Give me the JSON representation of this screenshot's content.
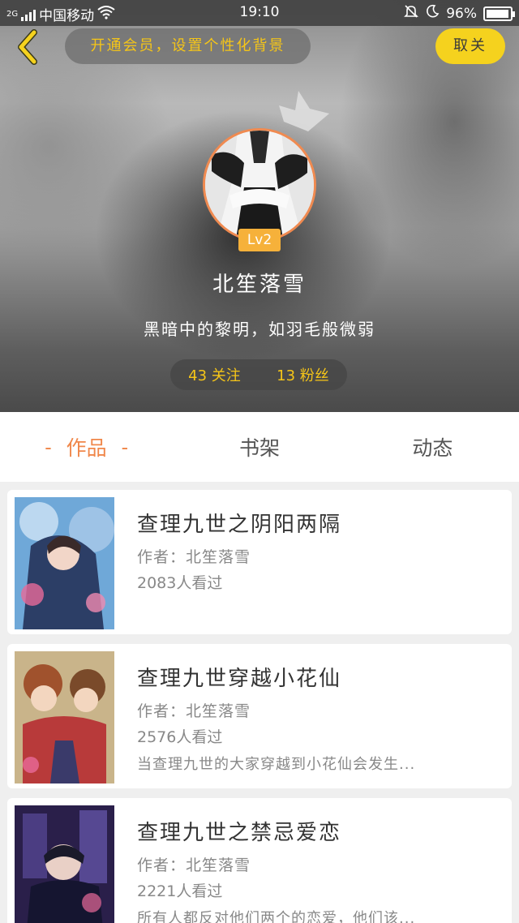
{
  "status_bar": {
    "carrier": "中国移动",
    "network": "2G",
    "time": "19:10",
    "battery": "96%",
    "battery_level": 0.96,
    "icons": [
      "signal-icon",
      "wifi-icon",
      "mute-icon",
      "moon-icon",
      "battery-icon"
    ]
  },
  "header": {
    "back_icon": "chevron-left-icon",
    "vip_text": "开通会员，设置个性化背景",
    "follow_button": "取关"
  },
  "profile": {
    "level": "Lv2",
    "nickname": "北笙落雪",
    "signature": "黑暗中的黎明，如羽毛般微弱",
    "following": "43 关注",
    "fans": "13 粉丝"
  },
  "tabs": [
    {
      "label": "作品",
      "active": true
    },
    {
      "label": "书架",
      "active": false
    },
    {
      "label": "动态",
      "active": false
    }
  ],
  "works": [
    {
      "title": "查理九世之阴阳两隔",
      "author": "作者：北笙落雪",
      "views": "2083人看过",
      "description": ""
    },
    {
      "title": "查理九世穿越小花仙",
      "author": "作者：北笙落雪",
      "views": "2576人看过",
      "description": "当查理九世的大家穿越到小花仙会发生..."
    },
    {
      "title": "查理九世之禁忌爱恋",
      "author": "作者：北笙落雪",
      "views": "2221人看过",
      "description": "所有人都反对他们两个的恋爱，他们该..."
    }
  ],
  "colors": {
    "accent": "#f0874a",
    "vip_text": "#f5c518",
    "follow_button": "#f5d21e",
    "level_badge": "#f6b13a"
  }
}
